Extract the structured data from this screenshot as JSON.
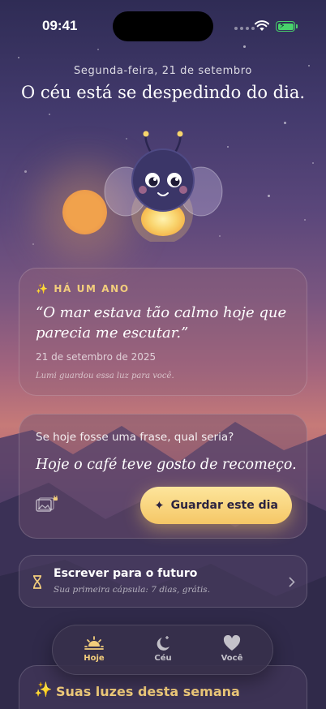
{
  "status_bar": {
    "time": "09:41"
  },
  "header": {
    "date": "Segunda-feira, 21 de setembro",
    "headline": "O céu está se despedindo do dia."
  },
  "memory_card": {
    "kicker": "HÁ UM ANO",
    "quote_line1": "“O mar estava tão calmo hoje que",
    "quote_line2": "parecia me escutar.”",
    "date": "21 de setembro de 2025",
    "footnote": "Lumi guardou essa luz para você."
  },
  "entry_card": {
    "prompt": "Se hoje fosse uma frase, qual seria?",
    "answer": "Hoje o café teve gosto de recomeço.",
    "save_label": "Guardar este dia"
  },
  "future_card": {
    "title": "Escrever para o futuro",
    "subtitle": "Sua primeira cápsula: 7 dias, grátis."
  },
  "tabs": [
    {
      "label": "Hoje",
      "icon": "sunrise-icon",
      "active": true
    },
    {
      "label": "Céu",
      "icon": "moon-stars-icon",
      "active": false
    },
    {
      "label": "Você",
      "icon": "heart-icon",
      "active": false
    }
  ],
  "week_card": {
    "title": "Suas luzes desta semana"
  },
  "colors": {
    "accent": "#f5c766",
    "kicker": "#f2cd7c"
  }
}
